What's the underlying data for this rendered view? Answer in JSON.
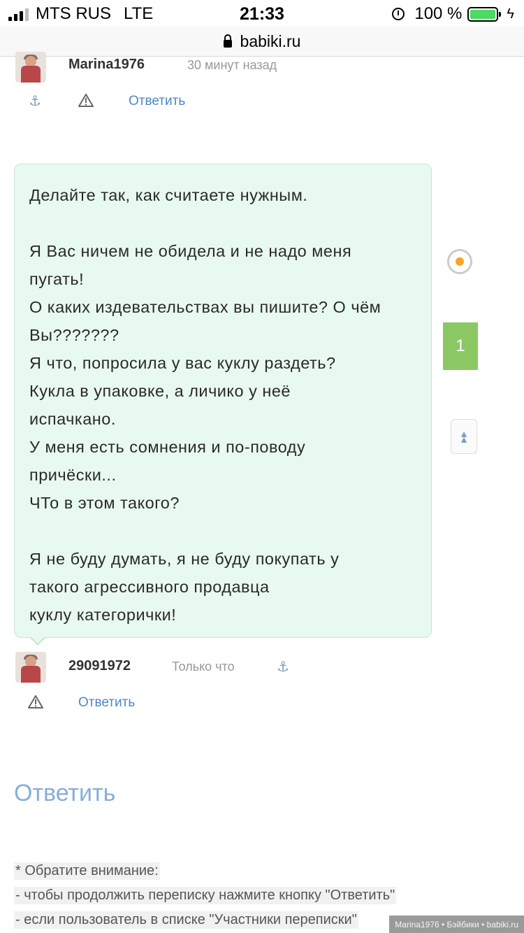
{
  "status_bar": {
    "carrier": "MTS RUS",
    "network": "LTE",
    "time": "21:33",
    "battery": "100 %"
  },
  "url": "babiki.ru",
  "comment1": {
    "username": "Marina1976",
    "time": "30 минут назад",
    "reply": "Ответить"
  },
  "message": {
    "lines": [
      "Делайте так, как считаете нужным.",
      "",
      "Я Вас ничем не обидела и не надо меня",
      "пугать!",
      "О каких издевательствах вы пишите? О чём",
      "Вы???????",
      "Я что, попросила у вас куклу раздеть?",
      "Кукла в упаковке, а личико у неё",
      "испачкано.",
      "У меня есть сомнения и по-поводу",
      "причёски...",
      "ЧТо в этом такого?",
      "",
      "Я не буду думать, я не буду покупать у",
      "такого агрессивного продавца",
      "куклу категорички!"
    ]
  },
  "side": {
    "count": "1"
  },
  "comment2": {
    "username": "29091972",
    "time": "Только что",
    "reply": "Ответить"
  },
  "reply_heading": "Ответить",
  "notice": {
    "line1": "* Обратите внимание:",
    "line2": "- чтобы продолжить переписку нажмите кнопку \"Ответить\"",
    "line3": "- если пользователь в списке \"Участники переписки\""
  },
  "footer": "Marina1976 • Бэйбики • babiki.ru",
  "icons": {
    "anchor": "anchor-icon",
    "warning": "warning-icon",
    "lock": "lock-icon",
    "alarm": "alarm-icon",
    "spinner": "loading-icon",
    "scroll_top": "scroll-top-icon"
  }
}
